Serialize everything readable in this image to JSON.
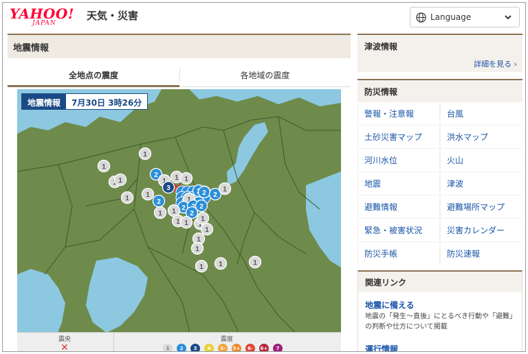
{
  "header": {
    "logo_text": "YAHOO!",
    "logo_sub": "JAPAN",
    "site_name": "天気・災害",
    "language_label": "Language"
  },
  "main": {
    "title": "地震情報",
    "tabs": [
      {
        "label": "全地点の震度",
        "active": true
      },
      {
        "label": "各地域の震度",
        "active": false
      }
    ],
    "badge_label": "地震情報",
    "badge_time": "7月30日 3時26分",
    "legend": {
      "epicenter_label": "震央",
      "intensity_label": "震度",
      "scale": [
        {
          "label": "1",
          "color": "#d9d9d9"
        },
        {
          "label": "2",
          "color": "#2b8fd8"
        },
        {
          "label": "3",
          "color": "#1b4a86"
        },
        {
          "label": "4",
          "color": "#e8d237"
        },
        {
          "label": "5-",
          "color": "#f2a33a"
        },
        {
          "label": "5+",
          "color": "#ef8a2c"
        },
        {
          "label": "6-",
          "color": "#e0442f"
        },
        {
          "label": "6+",
          "color": "#b3263a"
        },
        {
          "label": "7",
          "color": "#a0207a"
        }
      ]
    },
    "markers": [
      {
        "v": "1"
      },
      {
        "v": "1"
      },
      {
        "v": "1"
      },
      {
        "v": "1"
      },
      {
        "v": "1"
      },
      {
        "v": "1"
      },
      {
        "v": "2"
      },
      {
        "v": "1"
      },
      {
        "v": "1"
      },
      {
        "v": "3"
      },
      {
        "v": "1"
      },
      {
        "v": "2"
      },
      {
        "v": "2"
      },
      {
        "v": "2"
      },
      {
        "v": "1"
      },
      {
        "v": "2"
      },
      {
        "v": "2"
      },
      {
        "v": "2"
      },
      {
        "v": "2"
      },
      {
        "v": "2"
      },
      {
        "v": "1"
      },
      {
        "v": "1"
      },
      {
        "v": "1"
      },
      {
        "v": "1"
      },
      {
        "v": "1"
      },
      {
        "v": "1"
      },
      {
        "v": "1"
      },
      {
        "v": "1"
      },
      {
        "v": "1"
      },
      {
        "v": "1"
      },
      {
        "v": "1"
      },
      {
        "v": "1"
      },
      {
        "v": "1"
      }
    ]
  },
  "side": {
    "tsunami_title": "津波情報",
    "tsunami_link": "詳細を見る",
    "bousai_title": "防災情報",
    "bousai_items": [
      "警報・注意報",
      "台風",
      "土砂災害マップ",
      "洪水マップ",
      "河川水位",
      "火山",
      "地震",
      "津波",
      "避難情報",
      "避難場所マップ",
      "緊急・被害状況",
      "災害カレンダー",
      "防災手帳",
      "防災速報"
    ],
    "links_title": "関連リンク",
    "link1": "地震に備える",
    "link1_desc": "地震の「発生～直後」にとるべき行動や「避難」の判断や仕方について掲載",
    "link2": "運行情報"
  }
}
